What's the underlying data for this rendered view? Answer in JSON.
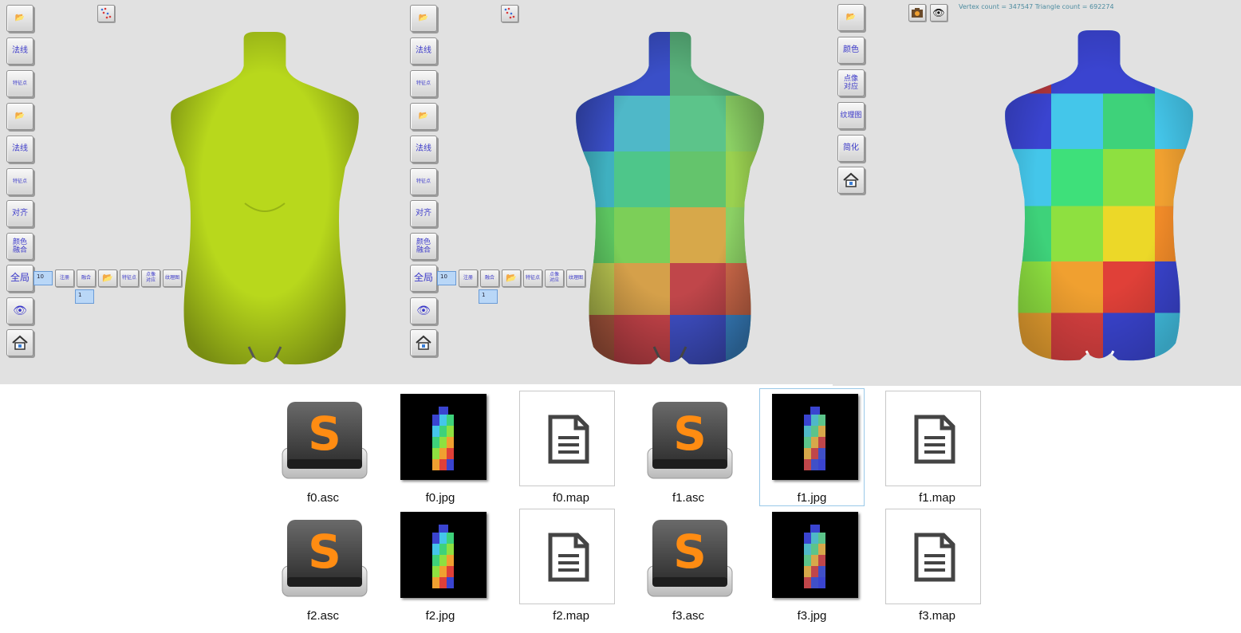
{
  "viewers": [
    {
      "id": "viewer-left",
      "toolbar": [
        "",
        "法线",
        "特征点",
        "",
        "法线",
        "特征点",
        "对齐",
        "颜色\n融合",
        "全局",
        "",
        ""
      ],
      "global_value": "10",
      "sub_buttons": [
        "注册",
        "融合",
        "",
        "特征点",
        "点像\n对应",
        "纹理图"
      ],
      "sub_value": "1"
    },
    {
      "id": "viewer-middle",
      "toolbar": [
        "",
        "法线",
        "特征点",
        "",
        "法线",
        "特征点",
        "对齐",
        "颜色\n融合",
        "全局",
        "",
        ""
      ],
      "global_value": "10",
      "sub_buttons": [
        "注册",
        "融合",
        "",
        "特征点",
        "点像\n对应",
        "纹理图"
      ],
      "sub_value": "1"
    },
    {
      "id": "viewer-right",
      "toolbar": [
        "",
        "颜色",
        "点像\n对应",
        "纹理图",
        "简化",
        ""
      ],
      "counts": "Vertex count = 347547  Triangle count = 692274"
    }
  ],
  "files": [
    {
      "name": "f0.asc",
      "type": "asc"
    },
    {
      "name": "f0.jpg",
      "type": "jpg"
    },
    {
      "name": "f0.map",
      "type": "map"
    },
    {
      "name": "f1.asc",
      "type": "asc"
    },
    {
      "name": "f1.jpg",
      "type": "jpg",
      "selected": true
    },
    {
      "name": "f1.map",
      "type": "map"
    },
    {
      "name": "f2.asc",
      "type": "asc"
    },
    {
      "name": "f2.jpg",
      "type": "jpg"
    },
    {
      "name": "f2.map",
      "type": "map"
    },
    {
      "name": "f3.asc",
      "type": "asc"
    },
    {
      "name": "f3.jpg",
      "type": "jpg"
    },
    {
      "name": "f3.map",
      "type": "map"
    }
  ],
  "colors": {
    "viewer_bg": "#e1e1e1",
    "button_text": "#3b39c9",
    "mesh_yellow": "#b8d81c",
    "counts_text": "#4d8ca0"
  }
}
